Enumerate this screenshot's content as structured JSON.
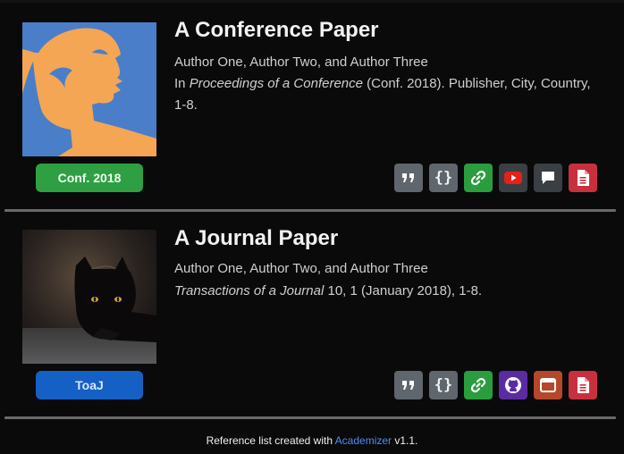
{
  "publications": [
    {
      "title": "A Conference Paper",
      "authors": "Author One, Author Two, and Author Three",
      "venue_prefix": "In ",
      "venue_name": "Proceedings of a Conference",
      "venue_rest": " (Conf. 2018). Publisher, City, Country, 1-8.",
      "badge": "Conf. 2018",
      "badge_color": "#2ea043",
      "thumbnail": "illustrated-profile-portrait",
      "actions": [
        "quote-icon",
        "braces-icon",
        "link-icon",
        "youtube-icon",
        "comment-icon",
        "pdf-icon"
      ]
    },
    {
      "title": "A Journal Paper",
      "authors": "Author One, Author Two, and Author Three",
      "venue_name": "Transactions of a Journal",
      "venue_rest": " 10, 1 (January 2018), 1-8.",
      "badge": "ToaJ",
      "badge_color": "#1560c4",
      "thumbnail": "black-cat-photo",
      "actions": [
        "quote-icon",
        "braces-icon",
        "link-icon",
        "github-icon",
        "window-icon",
        "pdf-icon"
      ]
    }
  ],
  "footer": {
    "prefix": "Reference list created with ",
    "link": "Academizer",
    "suffix": " v1.1."
  }
}
